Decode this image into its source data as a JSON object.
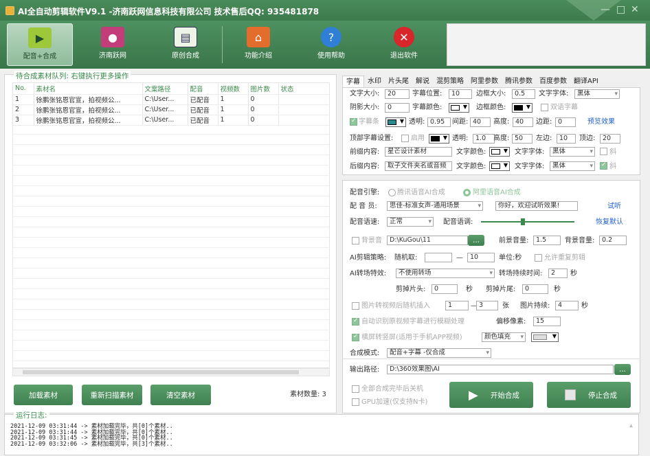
{
  "window": {
    "title": "AI全自动剪辑软件V9.1 -济南跃网信息科技有限公司 技术售后QQ: 935481878"
  },
  "toolbar": [
    {
      "label": "配音+合成",
      "icon": "clapper-icon",
      "active": true
    },
    {
      "label": "济南跃网",
      "icon": "film-reel-icon"
    },
    {
      "label": "原创合成",
      "icon": "picture-icon"
    },
    {
      "label": "功能介绍",
      "icon": "house-icon"
    },
    {
      "label": "使用帮助",
      "icon": "help-icon"
    },
    {
      "label": "退出软件",
      "icon": "exit-icon"
    }
  ],
  "queue": {
    "title": "待合成素材队列: 右键执行更多操作",
    "columns": [
      "No.",
      "素材名",
      "文案路径",
      "配音",
      "视频数",
      "图片数",
      "状态"
    ],
    "rows": [
      [
        "1",
        "徐鹏张铭恩官宣，拍视频公...",
        "C:\\User...",
        "已配音",
        "1",
        "0",
        ""
      ],
      [
        "2",
        "徐鹏张铭恩官宣，拍视频公...",
        "C:\\User...",
        "已配音",
        "1",
        "0",
        ""
      ],
      [
        "3",
        "徐鹏张铭恩官宣，拍视频公...",
        "C:\\User...",
        "已配音",
        "1",
        "0",
        ""
      ]
    ]
  },
  "buttons": {
    "load": "加载素材",
    "rescan": "重新扫描素材",
    "clear": "清空素材",
    "start": "开始合成",
    "stop": "停止合成"
  },
  "count_label": "素材数量: 3",
  "tabs": [
    "字幕",
    "水印",
    "片头尾",
    "解说",
    "混剪策略",
    "阿里参数",
    "腾讯参数",
    "百度参数",
    "翻译API"
  ],
  "subtitle": {
    "font_size_lbl": "文字大小:",
    "font_size": "20",
    "pos_lbl": "字幕位置:",
    "pos": "10",
    "border_lbl": "边框大小:",
    "border": "0.5",
    "font_lbl": "文字字体:",
    "font": "黑体",
    "shadow_lbl": "阴影大小:",
    "shadow": "0",
    "color_lbl": "字幕颜色:",
    "bcolor_lbl": "边框颜色:",
    "dual_lbl": "双语字幕",
    "bar_lbl": "字幕条",
    "opacity_lbl": "透明:",
    "opacity": "0.95",
    "spacing_lbl": "间距:",
    "spacing": "40",
    "height_lbl": "高度:",
    "height": "40",
    "margin_lbl": "边距:",
    "margin": "0",
    "preview": "预览效果",
    "top_lbl": "顶部字幕设置:",
    "top_enable": "启用",
    "top_opacity_lbl": "透明:",
    "top_opacity": "1.0",
    "top_height_lbl": "高度:",
    "top_height": "50",
    "left_lbl": "左边:",
    "left": "10",
    "topm_lbl": "顶边:",
    "topm": "20",
    "front_lbl": "前缀内容:",
    "front": "星芒设计素材",
    "tcolor_lbl": "文字颜色:",
    "tfont_lbl": "文字字体:",
    "tfont": "黑体",
    "italic": "斜",
    "back_lbl": "后缀内容:",
    "back": "取子文件夹名或音频",
    "tcolor2_lbl": "文字颜色:",
    "tfont2_lbl": "文字字体:",
    "tfont2": "黑体",
    "italic2": "斜"
  },
  "voice": {
    "engine_lbl": "配音引擎:",
    "engine1": "腾讯语音AI合成",
    "engine2": "阿里语音AI合成",
    "voice_lbl": "配 音 员:",
    "voice": "思佳-标准女声-通用场景",
    "sample": "你好，欢迎试听效果!",
    "listen": "试听",
    "speed_lbl": "配音语速:",
    "speed": "正常",
    "tone_lbl": "配音语调:",
    "reset": "恢复默认",
    "bgm_lbl": "背景音",
    "bgm_path": "D:\\KuGou\\11",
    "browse": "...",
    "fg_vol_lbl": "前景音量:",
    "fg_vol": "1.5",
    "bg_vol_lbl": "背景音量:",
    "bg_vol": "0.2",
    "strategy_lbl": "AI剪辑策略:",
    "strategy": "随机取:",
    "dash": "—",
    "strategy_to": "10",
    "unit": "单位:秒",
    "repeat_lbl": "允许重复剪辑",
    "trans_lbl": "AI转场特效:",
    "trans": "不使用转场",
    "trans_dur_lbl": "转场持续时间:",
    "trans_dur": "2",
    "sec": "秒",
    "cut_head_lbl": "剪掉片头:",
    "cut_head": "0",
    "sec2": "秒",
    "cut_tail_lbl": "剪掉片尾:",
    "cut_tail": "0",
    "sec3": "秒",
    "img_lbl": "图片转视频后随机插入",
    "img_from": "1",
    "img_dash": "—",
    "img_to": "3",
    "img_unit": "张",
    "img_dur_lbl": "图片持续:",
    "img_dur": "4",
    "sec4": "秒",
    "blur_lbl": "自动识别原视频字幕进行模糊处理",
    "offset_lbl": "偏移像素:",
    "offset": "15",
    "vertical_lbl": "横屏转竖屏(适用于手机APP视频)",
    "fill": "颜色填充",
    "mode_lbl": "合成模式:",
    "mode": "配音+字幕 -仅合成",
    "out_lbl": "输出路径:",
    "out": "D:\\360效果图\\AI",
    "out_browse": "...",
    "shutdown": "全部合成完毕后关机",
    "gpu": "GPU加速(仅支持N卡)"
  },
  "log": {
    "title": "运行日志:",
    "lines": [
      "2021-12-09 03:31:44 -> 素材加载完毕，共[0]个素材..",
      "2021-12-09 03:31:44 -> 素材加载完毕，共[0]个素材..",
      "2021-12-09 03:31:45 -> 素材加载完毕，共[0]个素材..",
      "2021-12-09 03:32:06 -> 素材加载完毕，共[3]个素材.."
    ]
  }
}
